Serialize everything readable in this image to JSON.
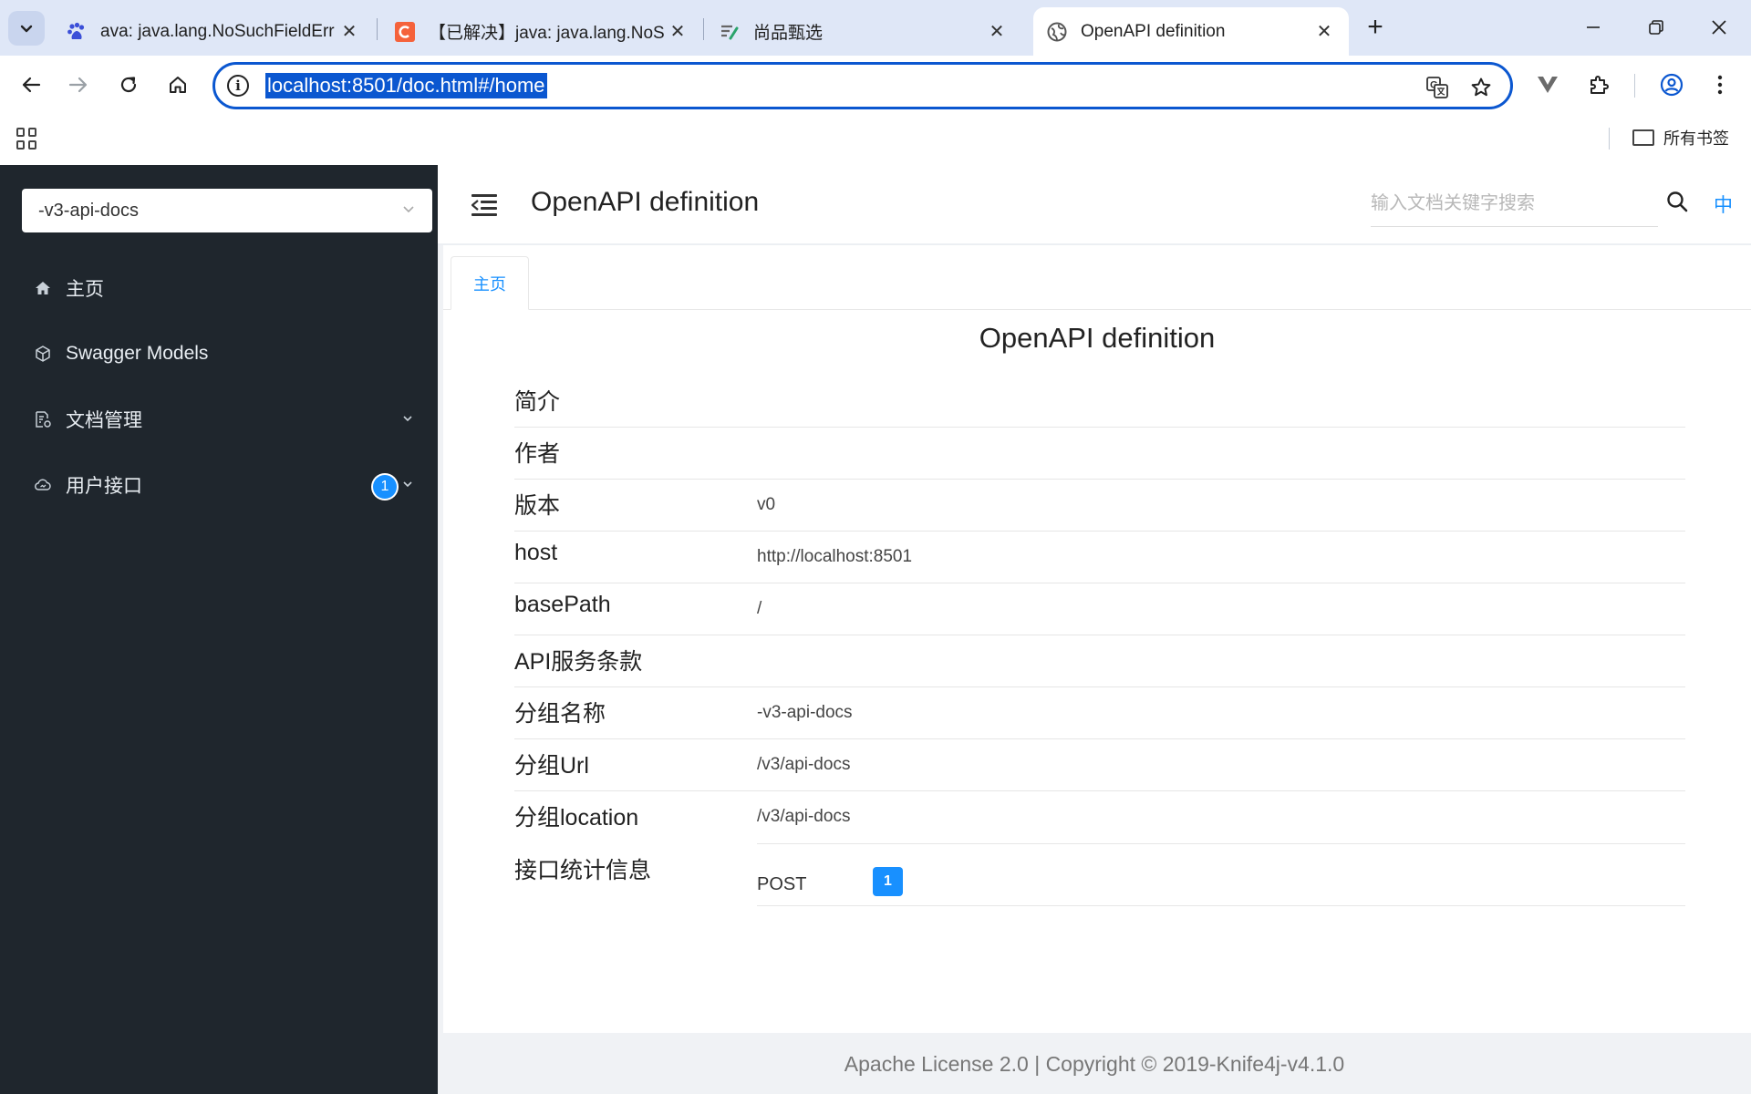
{
  "browser": {
    "tabs": [
      {
        "title": "ava: java.lang.NoSuchFieldErr",
        "favicon": "paw-icon",
        "active": false
      },
      {
        "title": "【已解决】java: java.lang.NoS",
        "favicon": "c-logo-icon",
        "active": false
      },
      {
        "title": "尚品甄选",
        "favicon": "note-icon",
        "active": false
      },
      {
        "title": "OpenAPI definition",
        "favicon": "globe-icon",
        "active": true
      }
    ],
    "new_tab_label": "+",
    "address": "localhost:8501/doc.html#/home",
    "bookmarks_folder": "所有书签",
    "accent_color": "#0b57d0"
  },
  "sidebar": {
    "group_select": "-v3-api-docs",
    "items": [
      {
        "label": "主页",
        "icon": "home-icon"
      },
      {
        "label": "Swagger Models",
        "icon": "cube-icon"
      },
      {
        "label": "文档管理",
        "icon": "doc-settings-icon"
      },
      {
        "label": "用户接口",
        "icon": "cloud-icon",
        "badge": "1"
      }
    ],
    "background": "#1f262d"
  },
  "header": {
    "title": "OpenAPI definition",
    "search_placeholder": "输入文档关键字搜索",
    "lang": "中"
  },
  "page_tab": "主页",
  "doc": {
    "title": "OpenAPI definition",
    "rows": [
      {
        "label": "简介",
        "value": ""
      },
      {
        "label": "作者",
        "value": ""
      },
      {
        "label": "版本",
        "value": "v0"
      },
      {
        "label": "host",
        "value": "http://localhost:8501"
      },
      {
        "label": "basePath",
        "value": "/"
      },
      {
        "label": "API服务条款",
        "value": ""
      },
      {
        "label": "分组名称",
        "value": "-v3-api-docs"
      },
      {
        "label": "分组Url",
        "value": "/v3/api-docs"
      },
      {
        "label": "分组location",
        "value": "/v3/api-docs"
      }
    ],
    "stats": {
      "label": "接口统计信息",
      "method": "POST",
      "count": "1"
    }
  },
  "footer": "Apache License 2.0 | Copyright © 2019-Knife4j-v4.1.0",
  "accent_color": "#1890ff"
}
